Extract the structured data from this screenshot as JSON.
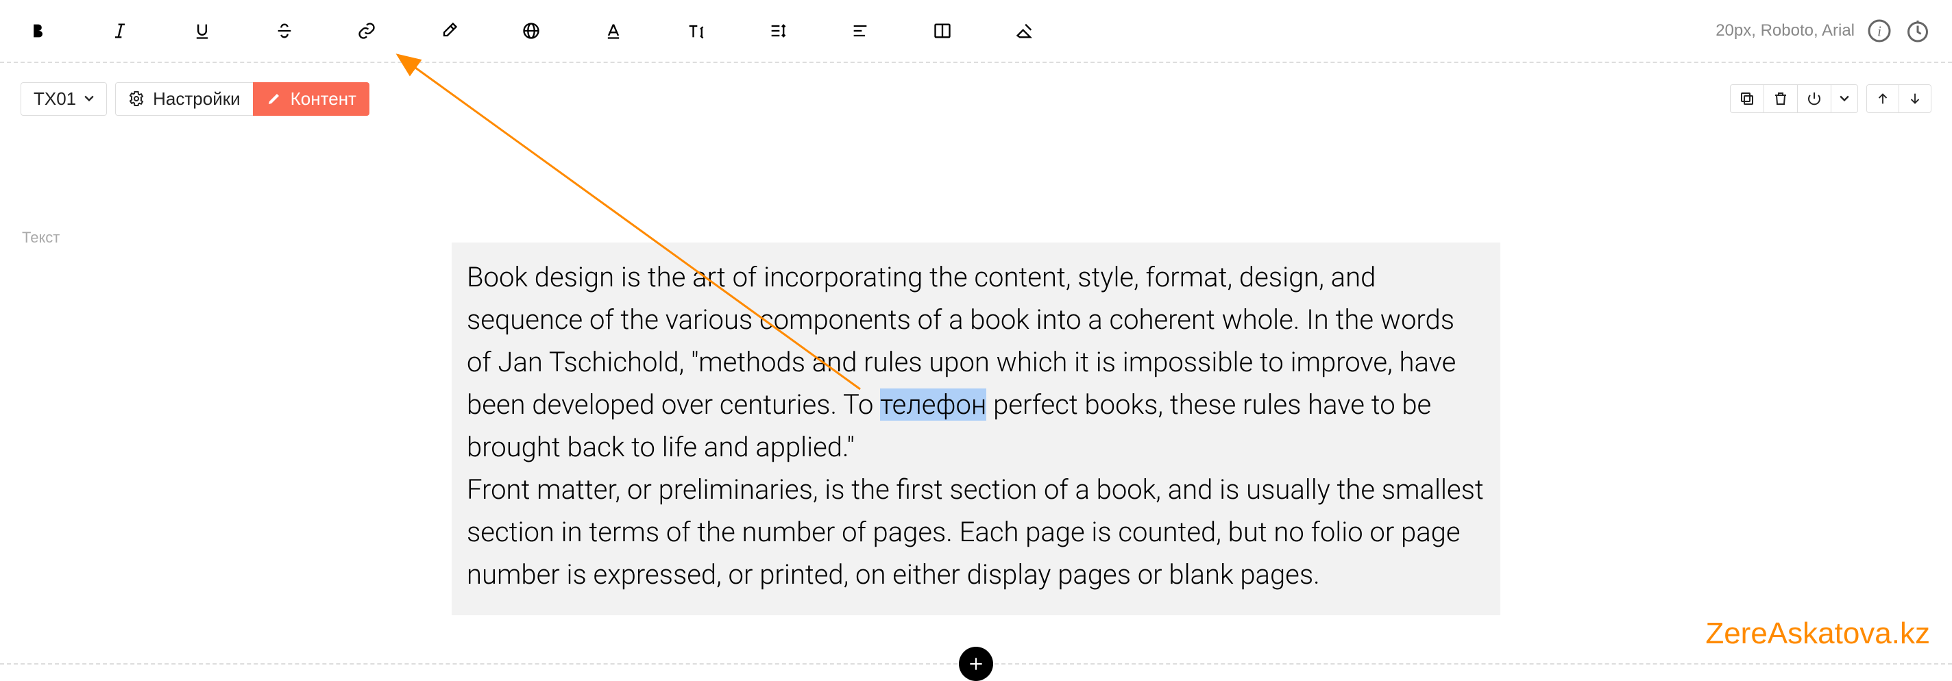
{
  "toolbar": {
    "font_info": "20px, Roboto, Arial"
  },
  "block": {
    "id_label": "TX01",
    "settings_label": "Настройки",
    "content_label": "Контент",
    "type_label": "Текст"
  },
  "text": {
    "p1_a": "Book design is the art of incorporating the content, style, format, design, and sequence of the various components of a book into a coherent whole. In the words of Jan Tschichold, \"methods and rules upon which it is impossible to improve, have been developed over centuries. To ",
    "p1_sel": "телефон",
    "p1_b": " perfect books, these rules have to be brought back to life and applied.\"",
    "p2": "Front matter, or preliminaries, is the first section of a book, and is usually the smallest section in terms of the number of pages. Each page is counted, but no folio or page number is expressed, or printed, on either display pages or blank pages."
  },
  "watermark": "ZereAskatova.kz"
}
